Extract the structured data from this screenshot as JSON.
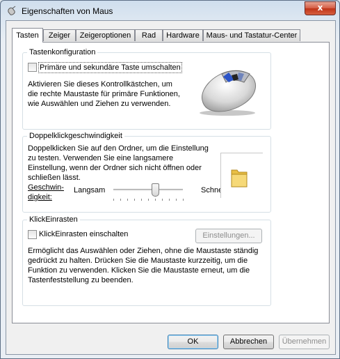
{
  "window": {
    "title": "Eigenschaften von Maus",
    "close_glyph": "x"
  },
  "tabs": [
    {
      "label": "Tasten",
      "active": true
    },
    {
      "label": "Zeiger"
    },
    {
      "label": "Zeigeroptionen"
    },
    {
      "label": "Rad"
    },
    {
      "label": "Hardware"
    },
    {
      "label": "Maus- und Tastatur-Center"
    }
  ],
  "buttons_config": {
    "legend": "Tastenkonfiguration",
    "swap_checkbox_label": "Primäre und sekundäre Taste umschalten",
    "swap_checked": false,
    "description": "Aktivieren Sie dieses Kontrollkästchen, um die rechte Maustaste für primäre Funktionen, wie Auswählen und Ziehen zu verwenden."
  },
  "doubleclick": {
    "legend": "Doppelklickgeschwindigkeit",
    "description": "Doppelklicken Sie auf den Ordner, um die Einstellung zu testen. Verwenden Sie eine langsamere Einstellung, wenn der Ordner sich nicht öffnen oder schließen lässt.",
    "speed_label": "Geschwin-\ndigkeit:",
    "slow_label": "Langsam",
    "fast_label": "Schnell",
    "speed_fraction": 0.6
  },
  "clicklock": {
    "legend": "KlickEinrasten",
    "checkbox_label": "KlickEinrasten einschalten",
    "checked": false,
    "settings_button": "Einstellungen...",
    "description": "Ermöglicht das Auswählen oder Ziehen, ohne die Maustaste ständig gedrückt zu halten. Drücken Sie die Maustaste kurzzeitig, um die Funktion zu verwenden. Klicken Sie die Maustaste erneut, um die Tastenfeststellung zu beenden."
  },
  "footer": {
    "ok": "OK",
    "cancel": "Abbrechen",
    "apply": "Übernehmen"
  },
  "icons": {
    "title_icon": "mouse-icon",
    "mouse_image": "mouse-image",
    "folder_icon": "folder-icon"
  }
}
